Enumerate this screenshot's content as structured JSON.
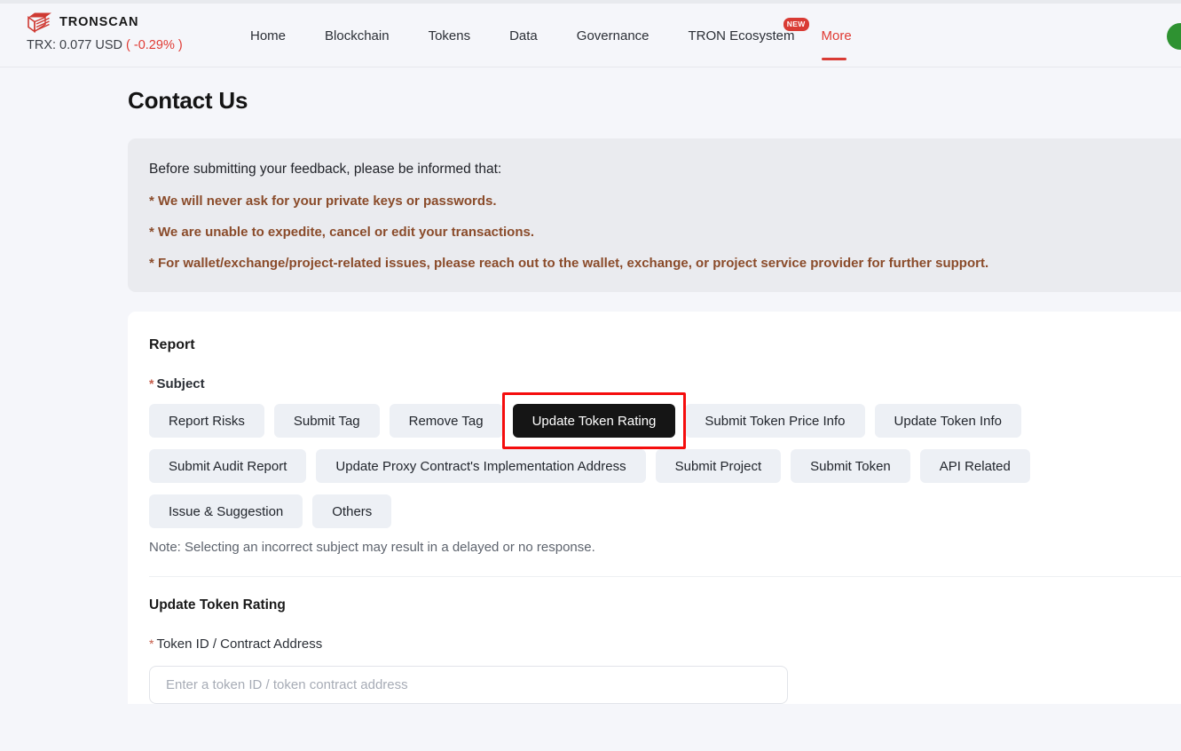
{
  "header": {
    "brand": {
      "name": "TRONSCAN",
      "logo_icon": "stacked-books-icon",
      "logo_color": "#cf3a33"
    },
    "price_ticker": {
      "text": "TRX: 0.077 USD",
      "change": "( -0.29% )",
      "change_color": "#e03b34"
    },
    "nav": [
      {
        "label": "Home",
        "active": false
      },
      {
        "label": "Blockchain",
        "active": false
      },
      {
        "label": "Tokens",
        "active": false
      },
      {
        "label": "Data",
        "active": false
      },
      {
        "label": "Governance",
        "active": false
      },
      {
        "label": "TRON Ecosystem",
        "active": false,
        "badge": "NEW"
      },
      {
        "label": "More",
        "active": true
      }
    ],
    "account_avatar": {
      "icon": "avatar-circle-icon",
      "color": "#2e9231"
    }
  },
  "main": {
    "page_title": "Contact Us",
    "notice": {
      "lead": "Before submitting your feedback, please be informed that:",
      "lines": [
        "* We will never ask for your private keys or passwords.",
        "* We are unable to expedite, cancel or edit your transactions.",
        "* For wallet/exchange/project-related issues, please reach out to the wallet, exchange, or project service provider for further support."
      ],
      "accent_color": "#8a4b2a",
      "background": "#eaebef"
    },
    "report": {
      "heading": "Report",
      "subject_label": "Subject",
      "subject_required": true,
      "subject_options": [
        {
          "label": "Report Risks",
          "selected": false
        },
        {
          "label": "Submit Tag",
          "selected": false
        },
        {
          "label": "Remove Tag",
          "selected": false
        },
        {
          "label": "Update Token Rating",
          "selected": true
        },
        {
          "label": "Submit Token Price Info",
          "selected": false
        },
        {
          "label": "Update Token Info",
          "selected": false
        },
        {
          "label": "Submit Audit Report",
          "selected": false
        },
        {
          "label": "Update Proxy Contract's Implementation Address",
          "selected": false
        },
        {
          "label": "Submit Project",
          "selected": false
        },
        {
          "label": "Submit Token",
          "selected": false
        },
        {
          "label": "API Related",
          "selected": false
        },
        {
          "label": "Issue & Suggestion",
          "selected": false
        },
        {
          "label": "Others",
          "selected": false
        }
      ],
      "note": "Note: Selecting an incorrect subject may result in a delayed or no response.",
      "selected_subject_color": "#151515",
      "highlight_color": "#f50d0d"
    },
    "form": {
      "section_heading": "Update Token Rating",
      "token_field": {
        "label": "Token ID / Contract Address",
        "required": true,
        "value": "",
        "placeholder": "Enter a token ID / token contract address"
      }
    }
  }
}
